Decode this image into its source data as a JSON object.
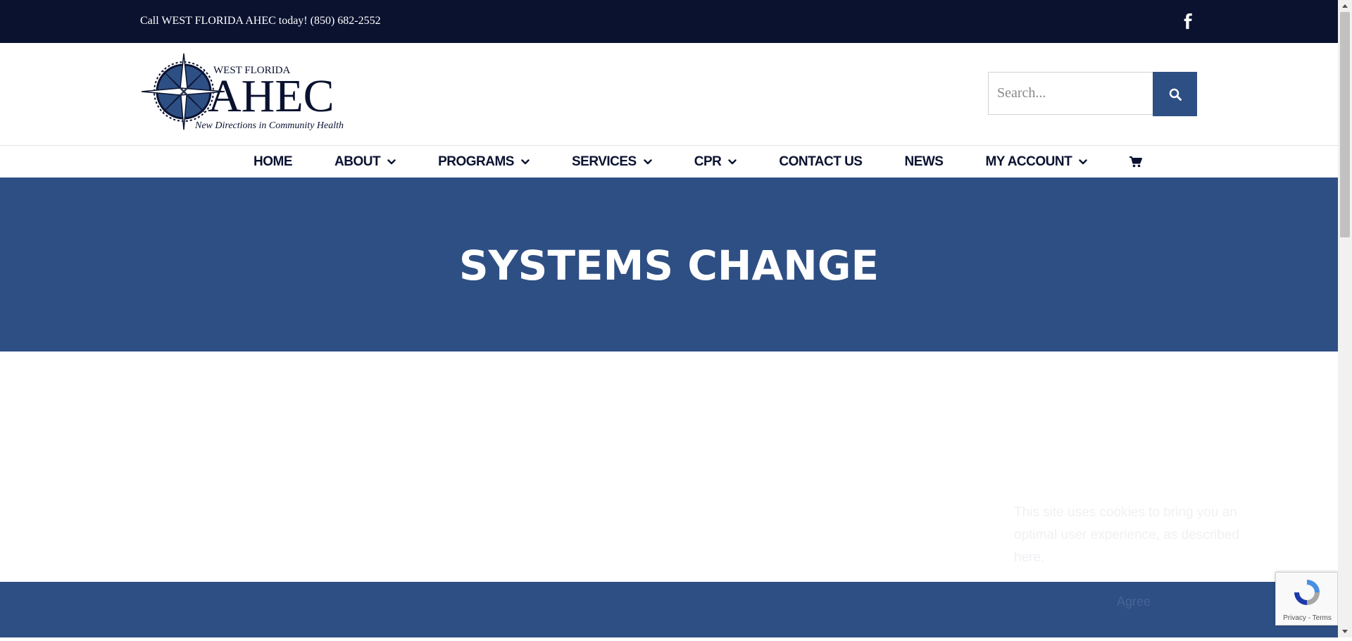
{
  "topbar": {
    "phone_text": "Call WEST FLORIDA AHEC today! (850) 682-2552",
    "social_icon": "facebook-icon"
  },
  "logo": {
    "top_text": "WEST FLORIDA",
    "brand_text": "AHEC",
    "tagline": "New Directions in Community Health"
  },
  "search": {
    "placeholder": "Search...",
    "button_icon": "search-icon"
  },
  "nav": {
    "items": [
      {
        "label": "HOME",
        "has_dropdown": false
      },
      {
        "label": "ABOUT",
        "has_dropdown": true
      },
      {
        "label": "PROGRAMS",
        "has_dropdown": true
      },
      {
        "label": "SERVICES",
        "has_dropdown": true
      },
      {
        "label": "CPR",
        "has_dropdown": true
      },
      {
        "label": "CONTACT US",
        "has_dropdown": false
      },
      {
        "label": "NEWS",
        "has_dropdown": false
      },
      {
        "label": "MY ACCOUNT",
        "has_dropdown": true
      }
    ],
    "cart_icon": "cart-icon"
  },
  "hero": {
    "title": "SYSTEMS CHANGE"
  },
  "cookie_notice": {
    "message": "This site uses cookies to bring you an optimal user experience, as described here.",
    "agree_label": "Agree"
  },
  "recaptcha": {
    "links": "Privacy - Terms"
  },
  "colors": {
    "topbar_bg": "#0a1230",
    "primary_blue": "#2e4f84",
    "nav_text": "#0a1230"
  }
}
